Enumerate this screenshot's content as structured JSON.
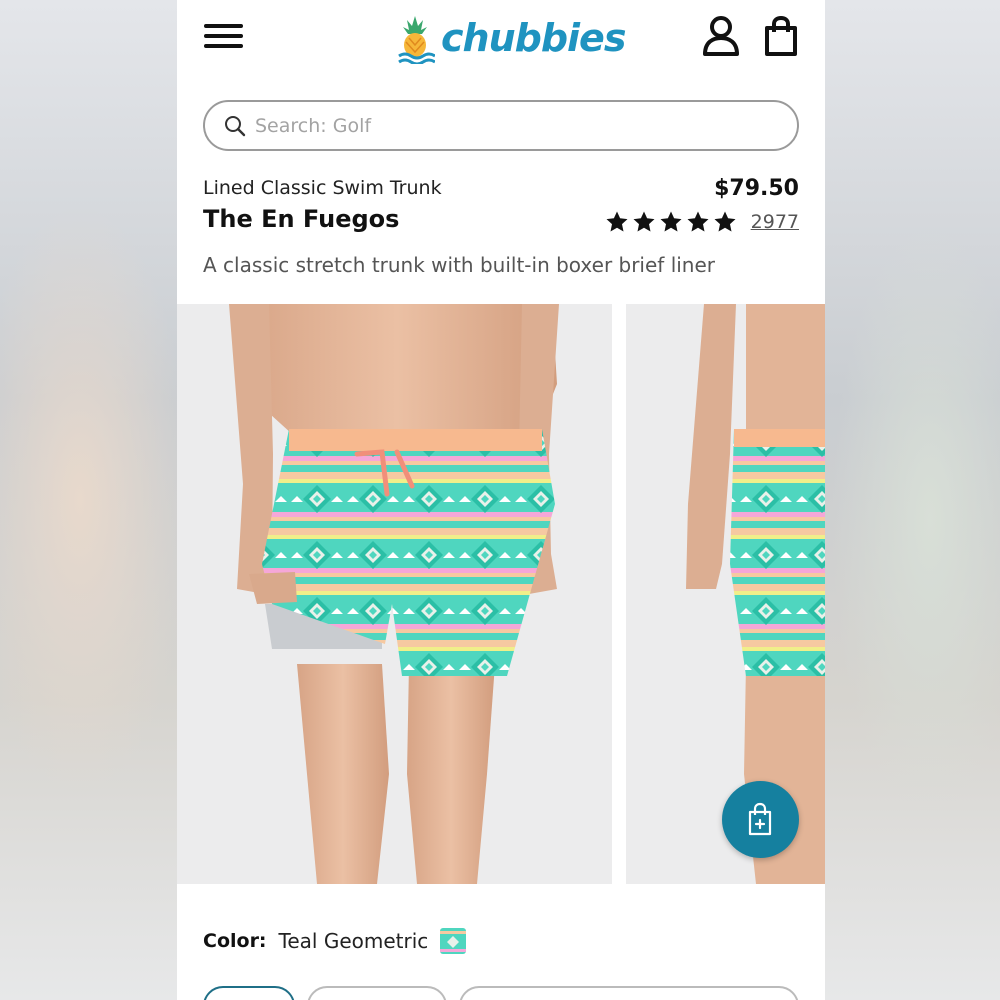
{
  "brand": {
    "name": "chubbies"
  },
  "search": {
    "placeholder": "Search: Golf",
    "value": ""
  },
  "product": {
    "type": "Lined Classic Swim Trunk",
    "name": "The En Fuegos",
    "price": "$79.50",
    "rating": 5,
    "review_count": "2977",
    "description": "A classic stretch trunk with built-in boxer brief liner"
  },
  "color": {
    "label": "Color:",
    "value": "Teal Geometric"
  },
  "icons": {
    "menu": "hamburger-menu-icon",
    "account": "account-icon",
    "bag": "shopping-bag-icon",
    "search": "search-icon",
    "star": "star-icon",
    "quick_add": "add-to-bag-icon"
  },
  "colors": {
    "accent": "#1f93c0",
    "fab": "#15809f"
  }
}
